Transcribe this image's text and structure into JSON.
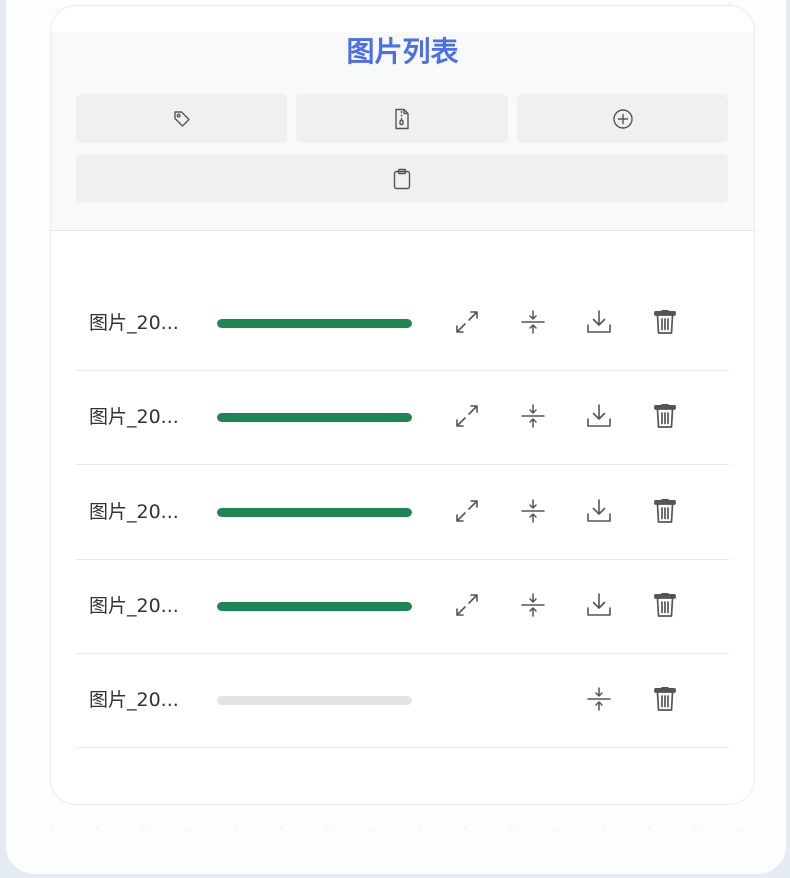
{
  "page": {
    "title": "图片列表"
  },
  "toolbar": {
    "buttons": [
      {
        "icon": "tag-icon"
      },
      {
        "icon": "zip-file-icon"
      },
      {
        "icon": "plus-circle-icon"
      },
      {
        "icon": "clipboard-icon"
      }
    ]
  },
  "images": [
    {
      "name": "图片_20...",
      "progress": 1.0,
      "actions": [
        "expand-icon",
        "compress-icon",
        "download-icon",
        "trash-icon"
      ]
    },
    {
      "name": "图片_20...",
      "progress": 1.0,
      "actions": [
        "expand-icon",
        "compress-icon",
        "download-icon",
        "trash-icon"
      ]
    },
    {
      "name": "图片_20...",
      "progress": 1.0,
      "actions": [
        "expand-icon",
        "compress-icon",
        "download-icon",
        "trash-icon"
      ]
    },
    {
      "name": "图片_20...",
      "progress": 1.0,
      "actions": [
        "expand-icon",
        "compress-icon",
        "download-icon",
        "trash-icon"
      ]
    },
    {
      "name": "图片_20...",
      "progress": 0.0,
      "actions": [
        "compress-icon",
        "trash-icon"
      ]
    }
  ],
  "colors": {
    "title": "#4c6ee8",
    "progress_fill": "#1e8653",
    "progress_track": "#e2e3e4",
    "button_bg": "#eff0f0",
    "icon": "#555555"
  }
}
